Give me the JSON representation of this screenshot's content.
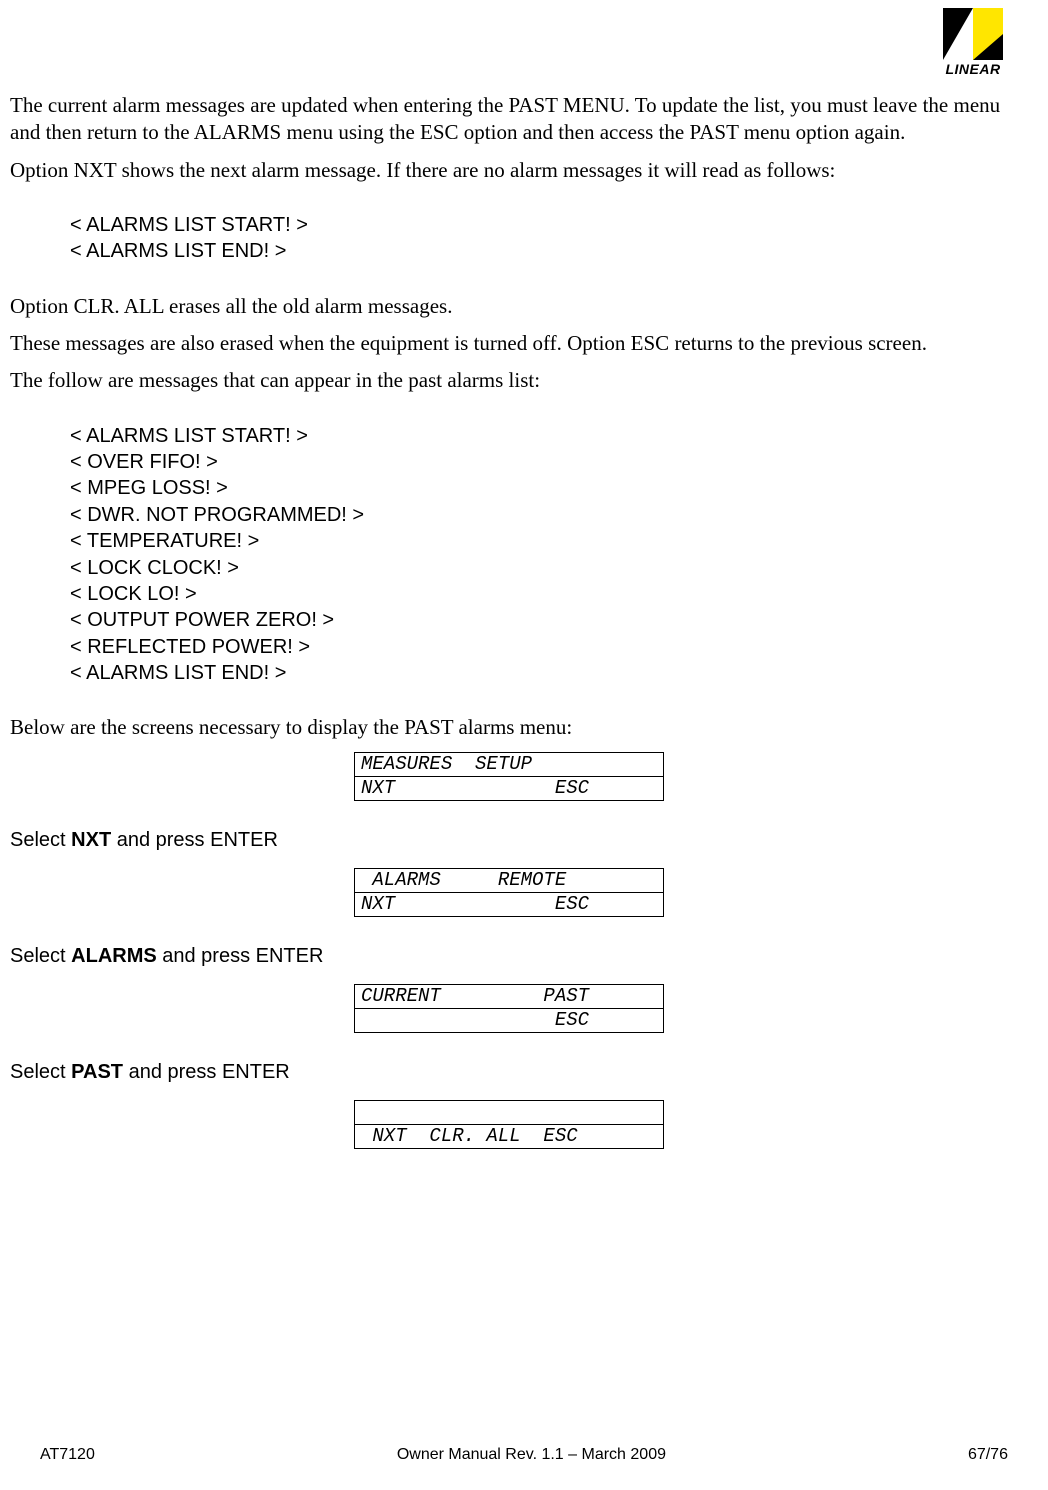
{
  "logo": {
    "text": "LINEAR"
  },
  "paragraphs": {
    "p1": "The current alarm messages are updated when entering the PAST MENU. To update the list, you must leave the menu and then return to the ALARMS menu using the ESC option and then access the PAST menu option again.",
    "p2": "Option NXT shows the next alarm message. If there are no alarm messages it will read as follows:",
    "p3": "Option CLR. ALL erases all the old alarm messages.",
    "p4": "These messages are also erased when the equipment is turned off. Option ESC returns to the previous screen.",
    "p5": "The follow are messages that can appear in the past alarms list:",
    "p6": "Below are the screens necessary to display the PAST alarms menu:"
  },
  "block1": [
    "< ALARMS LIST START! >",
    "< ALARMS LIST END! >"
  ],
  "block2": [
    "< ALARMS LIST START! >",
    "< OVER FIFO! >",
    "< MPEG LOSS! >",
    "< DWR. NOT PROGRAMMED! >",
    "< TEMPERATURE! >",
    "< LOCK CLOCK! >",
    "< LOCK   LO! >",
    "< OUTPUT POWER ZERO! >",
    "< REFLECTED POWER! >",
    "< ALARMS LIST END! >"
  ],
  "screens": {
    "s1": {
      "r1": "MEASURES  SETUP",
      "r2": "NXT              ESC"
    },
    "s2": {
      "r1": " ALARMS     REMOTE",
      "r2": "NXT              ESC"
    },
    "s3": {
      "r1": "CURRENT         PAST",
      "r2": "                 ESC"
    },
    "s4": {
      "r1": "",
      "r2": " NXT  CLR. ALL  ESC"
    }
  },
  "instructions": {
    "i1a": "Select ",
    "i1b": "NXT",
    "i1c": " and press ENTER",
    "i2a": "Select ",
    "i2b": "ALARMS",
    "i2c": " and press ENTER",
    "i3a": "Select ",
    "i3b": "PAST",
    "i3c": " and press ENTER"
  },
  "footer": {
    "left": "AT7120",
    "center": "Owner Manual Rev. 1.1 – March 2009",
    "right": "67/76"
  }
}
